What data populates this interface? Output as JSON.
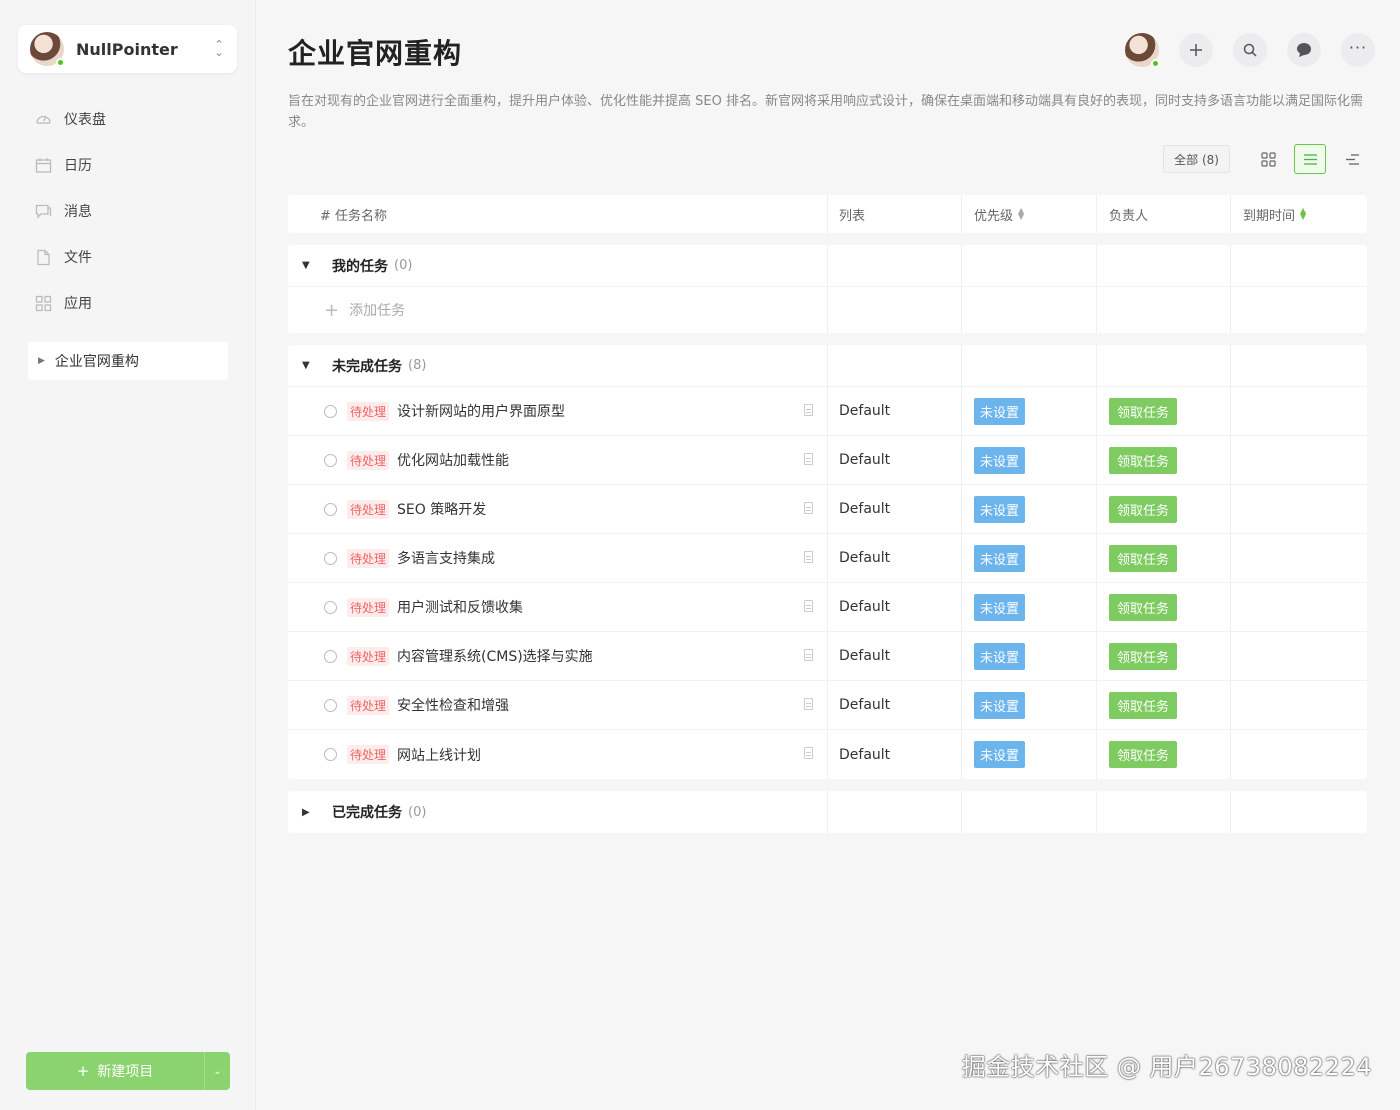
{
  "sidebar": {
    "user_name": "NullPointer",
    "nav": [
      {
        "label": "仪表盘",
        "icon": "dashboard-icon"
      },
      {
        "label": "日历",
        "icon": "calendar-icon"
      },
      {
        "label": "消息",
        "icon": "message-icon"
      },
      {
        "label": "文件",
        "icon": "file-icon"
      },
      {
        "label": "应用",
        "icon": "apps-icon"
      }
    ],
    "project": "企业官网重构",
    "new_project_label": "新建项目"
  },
  "header": {
    "title": "企业官网重构",
    "description": "旨在对现有的企业官网进行全面重构，提升用户体验、优化性能并提高 SEO 排名。新官网将采用响应式设计，确保在桌面端和移动端具有良好的表现，同时支持多语言功能以满足国际化需求。"
  },
  "toolbar": {
    "filter_label": "全部 (8)"
  },
  "table": {
    "columns": {
      "name": "# 任务名称",
      "list": "列表",
      "priority": "优先级",
      "assignee": "负责人",
      "due": "到期时间"
    },
    "my_tasks": {
      "title": "我的任务",
      "count": "(0)",
      "add_label": "添加任务"
    },
    "incomplete": {
      "title": "未完成任务",
      "count": "(8)"
    },
    "completed": {
      "title": "已完成任务",
      "count": "(0)"
    },
    "tasks": [
      {
        "status": "待处理",
        "name": "设计新网站的用户界面原型",
        "list": "Default",
        "priority": "未设置",
        "assignee": "领取任务"
      },
      {
        "status": "待处理",
        "name": "优化网站加载性能",
        "list": "Default",
        "priority": "未设置",
        "assignee": "领取任务"
      },
      {
        "status": "待处理",
        "name": "SEO 策略开发",
        "list": "Default",
        "priority": "未设置",
        "assignee": "领取任务"
      },
      {
        "status": "待处理",
        "name": "多语言支持集成",
        "list": "Default",
        "priority": "未设置",
        "assignee": "领取任务"
      },
      {
        "status": "待处理",
        "name": "用户测试和反馈收集",
        "list": "Default",
        "priority": "未设置",
        "assignee": "领取任务"
      },
      {
        "status": "待处理",
        "name": "内容管理系统(CMS)选择与实施",
        "list": "Default",
        "priority": "未设置",
        "assignee": "领取任务"
      },
      {
        "status": "待处理",
        "name": "安全性检查和增强",
        "list": "Default",
        "priority": "未设置",
        "assignee": "领取任务"
      },
      {
        "status": "待处理",
        "name": "网站上线计划",
        "list": "Default",
        "priority": "未设置",
        "assignee": "领取任务"
      }
    ]
  },
  "watermark": "掘金技术社区 @ 用户26738082224",
  "colors": {
    "accent_green": "#8bd36e",
    "tag_blue": "#6cb4ec",
    "status_red": "#f06464"
  }
}
